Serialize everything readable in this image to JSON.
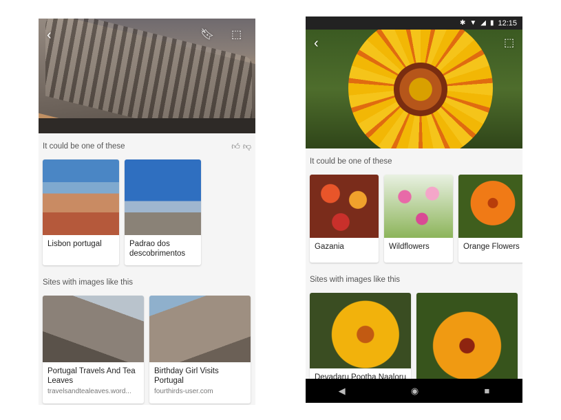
{
  "left": {
    "toolbar": {
      "back_icon": "chevron-left-icon",
      "bookmark_icon": "bookmark-icon",
      "visual_search_icon": "visual-search-icon"
    },
    "suggestions": {
      "heading": "It could be one of these",
      "items": [
        {
          "label": "Lisbon portugal"
        },
        {
          "label": "Padrao dos descobrimentos"
        }
      ]
    },
    "sites": {
      "heading": "Sites with images like this",
      "items": [
        {
          "title": "Portugal Travels And Tea Leaves",
          "domain": "travelsandtealeaves.word..."
        },
        {
          "title": "Birthday Girl Visits Portugal",
          "domain": "fourthirds-user.com"
        }
      ]
    }
  },
  "right": {
    "status": {
      "time": "12:15"
    },
    "suggestions": {
      "heading": "It could be one of these",
      "items": [
        {
          "label": "Gazania"
        },
        {
          "label": "Wildflowers"
        },
        {
          "label": "Orange Flowers"
        }
      ]
    },
    "sites": {
      "heading": "Sites with images like this",
      "items": [
        {
          "title": "Devadaru Pootha Naaloru"
        },
        {
          "title": ""
        }
      ]
    }
  }
}
